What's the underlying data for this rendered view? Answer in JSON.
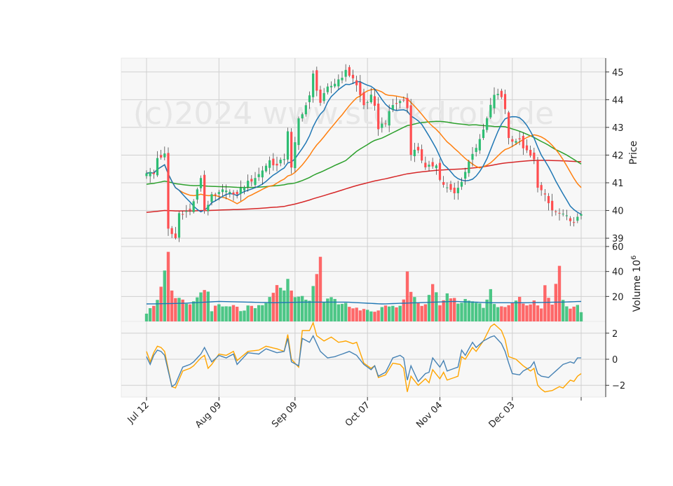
{
  "colors": {
    "up": "#2ebd72",
    "down": "#ff4d4f",
    "ma_short": "#1f77b4",
    "ma_mid": "#ff7f0e",
    "ma_long": "#2ca02c",
    "ma_longest": "#d62728",
    "vol_ma": "#1f77b4",
    "osc_a": "#4682b4",
    "osc_b": "#ffa500",
    "panel_bg": "#f7f7f7",
    "grid": "#d0d0d0"
  },
  "watermark": "(c)2024 www.stockdroid.de",
  "chart_data": [
    {
      "type": "candlestick",
      "ylabel": "Price",
      "ylim": [
        38.7,
        45.5
      ],
      "yticks": [
        39,
        40,
        41,
        42,
        43,
        44,
        45
      ],
      "xticks": [
        {
          "index": 0,
          "label": "Jul 12"
        },
        {
          "index": 20,
          "label": "Aug 09"
        },
        {
          "index": 41,
          "label": "Sep 09"
        },
        {
          "index": 61,
          "label": "Oct 07"
        },
        {
          "index": 81,
          "label": "Nov 04"
        },
        {
          "index": 101,
          "label": "Dec 03"
        },
        {
          "index": 120,
          "label": ""
        }
      ],
      "close_anchors": [
        [
          0,
          41.4
        ],
        [
          2,
          41.3
        ],
        [
          3,
          41.9
        ],
        [
          5,
          42.0
        ],
        [
          6,
          39.3
        ],
        [
          8,
          39.0
        ],
        [
          9,
          39.9
        ],
        [
          12,
          40.0
        ],
        [
          14,
          40.7
        ],
        [
          15,
          41.2
        ],
        [
          16,
          40.0
        ],
        [
          18,
          40.5
        ],
        [
          20,
          40.6
        ],
        [
          22,
          40.8
        ],
        [
          24,
          40.5
        ],
        [
          27,
          40.9
        ],
        [
          31,
          41.3
        ],
        [
          34,
          41.8
        ],
        [
          36,
          41.6
        ],
        [
          38,
          41.9
        ],
        [
          39,
          42.9
        ],
        [
          40,
          41.5
        ],
        [
          42,
          43.3
        ],
        [
          44,
          43.8
        ],
        [
          45,
          44.1
        ],
        [
          46,
          44.9
        ],
        [
          48,
          43.9
        ],
        [
          50,
          44.4
        ],
        [
          52,
          44.6
        ],
        [
          55,
          45.0
        ],
        [
          57,
          44.8
        ],
        [
          58,
          44.5
        ],
        [
          60,
          43.8
        ],
        [
          62,
          44.1
        ],
        [
          63,
          43.7
        ],
        [
          64,
          43.0
        ],
        [
          66,
          43.2
        ],
        [
          68,
          43.8
        ],
        [
          71,
          44.0
        ],
        [
          72,
          43.7
        ],
        [
          73,
          42.1
        ],
        [
          75,
          42.2
        ],
        [
          77,
          41.5
        ],
        [
          80,
          41.7
        ],
        [
          81,
          41.1
        ],
        [
          83,
          40.8
        ],
        [
          85,
          40.6
        ],
        [
          86,
          40.8
        ],
        [
          88,
          41.4
        ],
        [
          90,
          42.1
        ],
        [
          92,
          42.5
        ],
        [
          94,
          43.3
        ],
        [
          96,
          44.2
        ],
        [
          98,
          44.1
        ],
        [
          99,
          43.7
        ],
        [
          100,
          42.6
        ],
        [
          103,
          42.5
        ],
        [
          105,
          42.1
        ],
        [
          107,
          41.8
        ],
        [
          108,
          40.9
        ],
        [
          110,
          40.5
        ],
        [
          112,
          40.0
        ],
        [
          115,
          39.8
        ],
        [
          117,
          39.7
        ],
        [
          118,
          39.5
        ],
        [
          120,
          39.9
        ]
      ]
    },
    {
      "type": "bar",
      "ylabel": "Volume  10",
      "ylabel_exp": "6",
      "ylim": [
        0,
        60
      ],
      "yticks": [
        20,
        40,
        60
      ],
      "volume_anchors": [
        [
          0,
          8
        ],
        [
          1,
          12
        ],
        [
          3,
          16
        ],
        [
          6,
          55
        ],
        [
          7,
          23
        ],
        [
          8,
          18
        ],
        [
          10,
          16
        ],
        [
          12,
          12
        ],
        [
          14,
          20
        ],
        [
          16,
          25
        ],
        [
          17,
          24
        ],
        [
          18,
          10
        ],
        [
          20,
          12
        ],
        [
          22,
          11
        ],
        [
          24,
          12
        ],
        [
          26,
          9
        ],
        [
          28,
          11
        ],
        [
          30,
          10
        ],
        [
          33,
          14
        ],
        [
          35,
          24
        ],
        [
          36,
          28
        ],
        [
          38,
          23
        ],
        [
          39,
          35
        ],
        [
          41,
          18
        ],
        [
          43,
          22
        ],
        [
          45,
          15
        ],
        [
          48,
          52
        ],
        [
          49,
          14
        ],
        [
          51,
          20
        ],
        [
          53,
          14
        ],
        [
          55,
          15
        ],
        [
          57,
          10
        ],
        [
          60,
          11
        ],
        [
          62,
          10
        ],
        [
          64,
          8
        ],
        [
          66,
          12
        ],
        [
          67,
          10
        ],
        [
          70,
          12
        ],
        [
          71,
          16
        ],
        [
          72,
          42
        ],
        [
          73,
          25
        ],
        [
          75,
          15
        ],
        [
          77,
          12
        ],
        [
          79,
          28
        ],
        [
          80,
          22
        ],
        [
          81,
          14
        ],
        [
          83,
          22
        ],
        [
          85,
          17
        ],
        [
          87,
          15
        ],
        [
          89,
          18
        ],
        [
          91,
          15
        ],
        [
          93,
          12
        ],
        [
          95,
          26
        ],
        [
          96,
          14
        ],
        [
          99,
          10
        ],
        [
          101,
          15
        ],
        [
          103,
          18
        ],
        [
          105,
          13
        ],
        [
          107,
          16
        ],
        [
          109,
          12
        ],
        [
          110,
          28
        ],
        [
          112,
          13
        ],
        [
          114,
          46
        ],
        [
          115,
          16
        ],
        [
          117,
          11
        ],
        [
          119,
          14
        ],
        [
          120,
          9
        ]
      ],
      "vol_ma": [
        [
          0,
          14
        ],
        [
          10,
          14.5
        ],
        [
          20,
          16
        ],
        [
          35,
          15
        ],
        [
          45,
          15.5
        ],
        [
          55,
          15.5
        ],
        [
          65,
          14
        ],
        [
          75,
          15
        ],
        [
          85,
          16
        ],
        [
          95,
          15
        ],
        [
          105,
          15
        ],
        [
          115,
          15.5
        ],
        [
          120,
          16
        ]
      ]
    },
    {
      "type": "line",
      "ylim": [
        -2.9,
        2.9
      ],
      "yticks": [
        -2,
        0,
        2
      ],
      "series_a_anchors": [
        [
          0,
          0.2
        ],
        [
          1,
          -0.4
        ],
        [
          2,
          0.3
        ],
        [
          3,
          0.7
        ],
        [
          4,
          0.6
        ],
        [
          5,
          0.3
        ],
        [
          7,
          -2.1
        ],
        [
          8,
          -1.9
        ],
        [
          10,
          -0.6
        ],
        [
          12,
          -0.4
        ],
        [
          13,
          -0.2
        ],
        [
          15,
          0.4
        ],
        [
          16,
          0.9
        ],
        [
          18,
          -0.2
        ],
        [
          20,
          0.3
        ],
        [
          22,
          0.1
        ],
        [
          24,
          0.4
        ],
        [
          25,
          -0.4
        ],
        [
          28,
          0.5
        ],
        [
          31,
          0.4
        ],
        [
          33,
          0.8
        ],
        [
          36,
          0.5
        ],
        [
          38,
          0.6
        ],
        [
          39,
          1.6
        ],
        [
          40,
          -0.2
        ],
        [
          42,
          -0.5
        ],
        [
          43,
          1.6
        ],
        [
          45,
          1.3
        ],
        [
          46,
          1.8
        ],
        [
          48,
          0.6
        ],
        [
          50,
          0.1
        ],
        [
          52,
          0.2
        ],
        [
          54,
          0.4
        ],
        [
          56,
          0.6
        ],
        [
          58,
          0.3
        ],
        [
          60,
          -0.4
        ],
        [
          62,
          -0.8
        ],
        [
          63,
          -0.5
        ],
        [
          64,
          -1.3
        ],
        [
          66,
          -1.0
        ],
        [
          68,
          0.1
        ],
        [
          70,
          0.3
        ],
        [
          71,
          0.1
        ],
        [
          72,
          -1.6
        ],
        [
          73,
          -0.5
        ],
        [
          75,
          -1.7
        ],
        [
          77,
          -1.1
        ],
        [
          78,
          -1.0
        ],
        [
          79,
          0.1
        ],
        [
          81,
          -0.6
        ],
        [
          82,
          -0.1
        ],
        [
          83,
          -0.9
        ],
        [
          86,
          -0.6
        ],
        [
          87,
          0.7
        ],
        [
          88,
          0.3
        ],
        [
          90,
          1.3
        ],
        [
          91,
          0.9
        ],
        [
          93,
          1.4
        ],
        [
          95,
          1.7
        ],
        [
          96,
          1.8
        ],
        [
          98,
          1.2
        ],
        [
          99,
          0.6
        ],
        [
          100,
          -0.3
        ],
        [
          101,
          -1.1
        ],
        [
          103,
          -1.2
        ],
        [
          104,
          -0.9
        ],
        [
          106,
          -0.6
        ],
        [
          107,
          -0.2
        ],
        [
          108,
          -1.1
        ],
        [
          109,
          -1.3
        ],
        [
          111,
          -1.4
        ],
        [
          113,
          -0.9
        ],
        [
          115,
          -0.4
        ],
        [
          117,
          -0.2
        ],
        [
          118,
          -0.3
        ],
        [
          119,
          0.1
        ],
        [
          120,
          0.1
        ]
      ],
      "series_b_anchors": [
        [
          0,
          0.6
        ],
        [
          1,
          -0.2
        ],
        [
          2,
          0.5
        ],
        [
          3,
          1.0
        ],
        [
          4,
          0.9
        ],
        [
          5,
          0.6
        ],
        [
          7,
          -2.1
        ],
        [
          8,
          -2.2
        ],
        [
          10,
          -0.9
        ],
        [
          12,
          -0.7
        ],
        [
          13,
          -0.5
        ],
        [
          15,
          0.1
        ],
        [
          16,
          0.3
        ],
        [
          17,
          -0.7
        ],
        [
          18,
          -0.4
        ],
        [
          20,
          0.4
        ],
        [
          22,
          0.3
        ],
        [
          24,
          0.6
        ],
        [
          25,
          -0.1
        ],
        [
          28,
          0.6
        ],
        [
          31,
          0.7
        ],
        [
          33,
          1.0
        ],
        [
          36,
          0.8
        ],
        [
          38,
          0.6
        ],
        [
          39,
          1.9
        ],
        [
          40,
          0.0
        ],
        [
          42,
          -0.6
        ],
        [
          43,
          2.2
        ],
        [
          45,
          2.2
        ],
        [
          46,
          2.8
        ],
        [
          47,
          1.8
        ],
        [
          49,
          1.4
        ],
        [
          51,
          1.7
        ],
        [
          53,
          1.3
        ],
        [
          55,
          1.4
        ],
        [
          57,
          1.2
        ],
        [
          58,
          1.3
        ],
        [
          60,
          -0.3
        ],
        [
          62,
          -0.7
        ],
        [
          63,
          -0.5
        ],
        [
          64,
          -1.4
        ],
        [
          66,
          -1.2
        ],
        [
          68,
          -0.3
        ],
        [
          70,
          -0.4
        ],
        [
          71,
          -0.7
        ],
        [
          72,
          -2.5
        ],
        [
          73,
          -1.3
        ],
        [
          75,
          -2.0
        ],
        [
          77,
          -1.5
        ],
        [
          78,
          -1.8
        ],
        [
          79,
          -0.8
        ],
        [
          81,
          -1.5
        ],
        [
          82,
          -1.0
        ],
        [
          83,
          -1.6
        ],
        [
          86,
          -1.3
        ],
        [
          87,
          0.2
        ],
        [
          88,
          0.0
        ],
        [
          90,
          0.9
        ],
        [
          91,
          0.6
        ],
        [
          93,
          1.4
        ],
        [
          95,
          2.5
        ],
        [
          96,
          2.7
        ],
        [
          98,
          2.2
        ],
        [
          99,
          1.5
        ],
        [
          100,
          0.2
        ],
        [
          102,
          0.0
        ],
        [
          104,
          -0.5
        ],
        [
          106,
          -0.9
        ],
        [
          107,
          -0.7
        ],
        [
          108,
          -2.0
        ],
        [
          109,
          -2.3
        ],
        [
          110,
          -2.5
        ],
        [
          112,
          -2.4
        ],
        [
          114,
          -2.1
        ],
        [
          115,
          -2.2
        ],
        [
          117,
          -1.6
        ],
        [
          118,
          -1.7
        ],
        [
          119,
          -1.3
        ],
        [
          120,
          -1.1
        ]
      ]
    }
  ]
}
